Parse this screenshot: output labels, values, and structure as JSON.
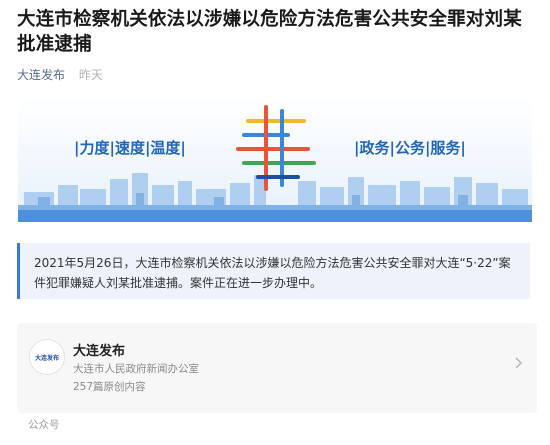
{
  "article": {
    "title": "大连市检察机关依法以涉嫌以危险方法危害公共安全罪对刘某批准逮捕",
    "source": "大连发布",
    "time": "昨天"
  },
  "banner": {
    "left_slogan": "|力度|速度|温度|",
    "right_slogan": "|政务|公务|服务|"
  },
  "notice": {
    "text": "2021年5月26日，大连市检察机关依法以涉嫌以危险方法危害公共安全罪对大连“5·22”案件犯罪嫌疑人刘某批准逮捕。案件正在进一步办理中。"
  },
  "account_card": {
    "logo_text": "大连发布",
    "name": "大连发布",
    "description": "大连市人民政府新闻办公室",
    "count": "257篇原创内容",
    "label": "公众号"
  },
  "colors": {
    "link": "#576b95",
    "accent_blue": "#3b7bd0",
    "notice_bg": "#eef3fb"
  }
}
